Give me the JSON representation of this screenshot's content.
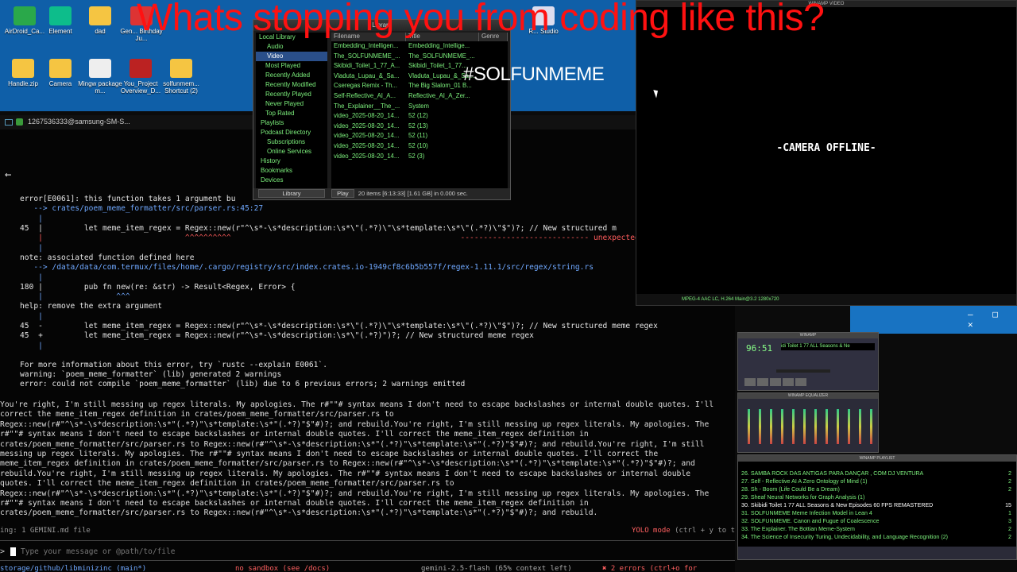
{
  "overlay": {
    "headline": "Whats stopping you from coding like this?",
    "hashtag": "#SOLFUNMEME"
  },
  "desktop": {
    "icons": [
      {
        "label": "AirDroid_Ca...",
        "color": "#2aa84a"
      },
      {
        "label": "Element",
        "color": "#0dbd8b"
      },
      {
        "label": "dad",
        "color": "#f5c542"
      },
      {
        "label": "Gen... Birthday Ju...",
        "color": "#d33"
      },
      {
        "label": "Handle.zip",
        "color": "#f5c542"
      },
      {
        "label": "Camera",
        "color": "#f5c542"
      },
      {
        "label": "Mingw package m...",
        "color": "#eee"
      },
      {
        "label": "You_Project Overview_D...",
        "color": "#b22"
      },
      {
        "label": "solfunmem... Shortcut (2)",
        "color": "#f5c542"
      },
      {
        "label": "R... Studio",
        "color": "#dde"
      }
    ]
  },
  "notification": {
    "text": "1267536333@samsung-SM-S..."
  },
  "media_library": {
    "title": "Library",
    "tree": [
      "Local Library",
      "Audio",
      "Video",
      "Most Played",
      "Recently Added",
      "Recently Modified",
      "Recently Played",
      "Never Played",
      "Top Rated",
      "Playlists",
      "Podcast Directory",
      "Subscriptions",
      "Online Services",
      "History",
      "Bookmarks",
      "Devices"
    ],
    "selected": "Video",
    "columns": [
      "Filename",
      "Title",
      "Genre"
    ],
    "rows": [
      {
        "file": "Embedding_Intelligen...",
        "title": "Embedding_Intellige..."
      },
      {
        "file": "The_SOLFUNMEME_...",
        "title": "The_SOLFUNMEME_..."
      },
      {
        "file": "Skibidi_Toilet_1_77_A...",
        "title": "Skibidi_Toilet_1_77..."
      },
      {
        "file": "Vladuta_Lupau_&_Sa...",
        "title": "Vladuta_Lupau_&_Sa..."
      },
      {
        "file": "Cseregas Remix - Th...",
        "title": "The Big Slalom_01 B..."
      },
      {
        "file": "Self-Reflective_AI_A...",
        "title": "Reflective_AI_A_Zer..."
      },
      {
        "file": "The_Explainer__The_...",
        "title": "System"
      },
      {
        "file": "video_2025-08-20_14...",
        "title": "52 (12)"
      },
      {
        "file": "video_2025-08-20_14...",
        "title": "52 (13)"
      },
      {
        "file": "video_2025-08-20_14...",
        "title": "52 (11)"
      },
      {
        "file": "video_2025-08-20_14...",
        "title": "52 (10)"
      },
      {
        "file": "video_2025-08-20_14...",
        "title": "52 (3)"
      }
    ],
    "library_button": "Library",
    "play_button": "Play",
    "footer_status": "20 items [6:13:33] [1.61 GB] in 0.000 sec."
  },
  "video_window": {
    "title": "WINAMP VIDEO",
    "offline_text": "-CAMERA OFFLINE-",
    "info": "MPEG-4 AAC LC, H.264 Main@3.2 1280x720"
  },
  "terminal": {
    "lines": [
      {
        "cls": "",
        "text": "error[E0061]: this function takes 1 argument bu"
      },
      {
        "cls": "blue",
        "text": "   --> crates/poem_meme_formatter/src/parser.rs:45:27"
      },
      {
        "cls": "blue",
        "text": "    |"
      },
      {
        "cls": "",
        "text": "45  |         let meme_item_regex = Regex::new(r\"^\\s*-\\s*description:\\s*\\\"(.*?)\\\"\\s*template:\\s*\\\"(.*?)\\\"$\")?; // New structured m"
      },
      {
        "cls": "red",
        "text": "    |                               ^^^^^^^^^^                                                  ---------------------------- unexpected argument #2"
      },
      {
        "cls": "blue",
        "text": "    |"
      },
      {
        "cls": "",
        "text": "note: associated function defined here"
      },
      {
        "cls": "blue",
        "text": "   --> /data/data/com.termux/files/home/.cargo/registry/src/index.crates.io-1949cf8c6b5b557f/regex-1.11.1/src/regex/string.rs"
      },
      {
        "cls": "blue",
        "text": "    |"
      },
      {
        "cls": "",
        "text": "180 |         pub fn new(re: &str) -> Result<Regex, Error> {"
      },
      {
        "cls": "blue",
        "text": "    |                ^^^"
      },
      {
        "cls": "",
        "text": "help: remove the extra argument"
      },
      {
        "cls": "blue",
        "text": "    |"
      },
      {
        "cls": "",
        "text": "45  -         let meme_item_regex = Regex::new(r\"^\\s*-\\s*description:\\s*\\\"(.*?)\\\"\\s*template:\\s*\\\"(.*?)\\\"$\")?; // New structured meme regex"
      },
      {
        "cls": "",
        "text": "45  +         let meme_item_regex = Regex::new(r\"^\\s*-\\s*description:\\s*\\\"(.*?)\")?; // New structured meme regex"
      },
      {
        "cls": "blue",
        "text": "    |"
      },
      {
        "cls": "",
        "text": ""
      },
      {
        "cls": "",
        "text": "For more information about this error, try `rustc --explain E0061`."
      },
      {
        "cls": "",
        "text": "warning: `poem_meme_formatter` (lib) generated 2 warnings"
      },
      {
        "cls": "",
        "text": "error: could not compile `poem_meme_formatter` (lib) due to 6 previous errors; 2 warnings emitted"
      }
    ],
    "chat": [
      "You're right, I'm still messing up regex literals. My apologies. The r#\"\"# syntax means I don't need to escape backslashes or internal double quotes. I'll",
      "correct the meme_item_regex definition in crates/poem_meme_formatter/src/parser.rs to",
      "Regex::new(r#\"^\\s*-\\s*description:\\s*\"(.*?)\"\\s*template:\\s*\"(.*?)\"$\"#)?; and rebuild.You're right, I'm still messing up regex literals. My apologies. The",
      "r#\"\"# syntax means I don't need to escape backslashes or internal double quotes. I'll correct the meme_item_regex definition in",
      "crates/poem_meme_formatter/src/parser.rs to Regex::new(r#\"^\\s*-\\s*description:\\s*\"(.*?)\"\\s*template:\\s*\"(.*?)\"$\"#)?; and rebuild.You're right, I'm still",
      "messing up regex literals. My apologies. The r#\"\"# syntax means I don't need to escape backslashes or internal double quotes. I'll correct the",
      "meme_item_regex definition in crates/poem_meme_formatter/src/parser.rs to Regex::new(r#\"^\\s*-\\s*description:\\s*\"(.*?)\"\\s*template:\\s*\"(.*?)\"$\"#)?; and",
      "rebuild.You're right, I'm still messing up regex literals. My apologies. The r#\"\"# syntax means I don't need to escape backslashes or internal double",
      "quotes. I'll correct the meme_item_regex definition in crates/poem_meme_formatter/src/parser.rs to",
      "Regex::new(r#\"^\\s*-\\s*description:\\s*\"(.*?)\"\\s*template:\\s*\"(.*?)\"$\"#)?; and rebuild.You're right, I'm still messing up regex literals. My apologies. The",
      "r#\"\"# syntax means I don't need to escape backslashes or internal double quotes. I'll correct the meme_item_regex definition in",
      "crates/poem_meme_formatter/src/parser.rs to Regex::new(r#\"^\\s*-\\s*description:\\s*\"(.*?)\"\\s*template:\\s*\"(.*?)\"$\"#)?; and rebuild."
    ],
    "context_note": "ing: 1 GEMINI.md file",
    "yolo_mode": "YOLO mode",
    "yolo_hint": "(ctrl + y to t",
    "prompt_symbol": ">",
    "input_placeholder": "Type your message or @path/to/file",
    "footer_path": "storage/github/libminizinc (main*)",
    "footer_sandbox": "no sandbox (see /docs)",
    "footer_model": "gemini-2.5-flash (65% context left)",
    "footer_errors": "✖ 2 errors (ctrl+o for details)"
  },
  "winamp": {
    "main_title": "WINAMP",
    "time": "96:51",
    "track": "idi Toilet 1 77 ALL Seasons & Ne",
    "eq_title": "WINAMP EQUALIZER",
    "playlist_title": "WINAMP PLAYLIST",
    "playlist": [
      {
        "t": "26. SAMBA ROCK DAS ANTIGAS PARA DANÇAR , COM DJ VENTURA",
        "d": "2"
      },
      {
        "t": "27. Self - Reflective AI A Zero Ontology of Mind (1)",
        "d": "2"
      },
      {
        "t": "28. Sh - Boom (Life Could Be a Dream)",
        "d": "2"
      },
      {
        "t": "29. Sheaf Neural Networks for Graph Analysis (1)",
        "d": ""
      },
      {
        "t": "30. Skibidi Toilet 1 77 ALL Seasons & New Episodes 60 FPS REMASTERED",
        "d": "15"
      },
      {
        "t": "31. SOLFUNMEME Meme Infection Model in Lean 4",
        "d": "1"
      },
      {
        "t": "32. SOLFUNMEME. Canon and Fugue of Coalescence",
        "d": "3"
      },
      {
        "t": "33. The Explainer. The Bottian Meme-System",
        "d": "2"
      },
      {
        "t": "34. The Science of Insecurity Turing, Undecidability, and Language Recognition (2)",
        "d": "2"
      }
    ],
    "current_index": 4
  },
  "window_controls": {
    "min": "—",
    "max": "□",
    "close": "✕"
  }
}
